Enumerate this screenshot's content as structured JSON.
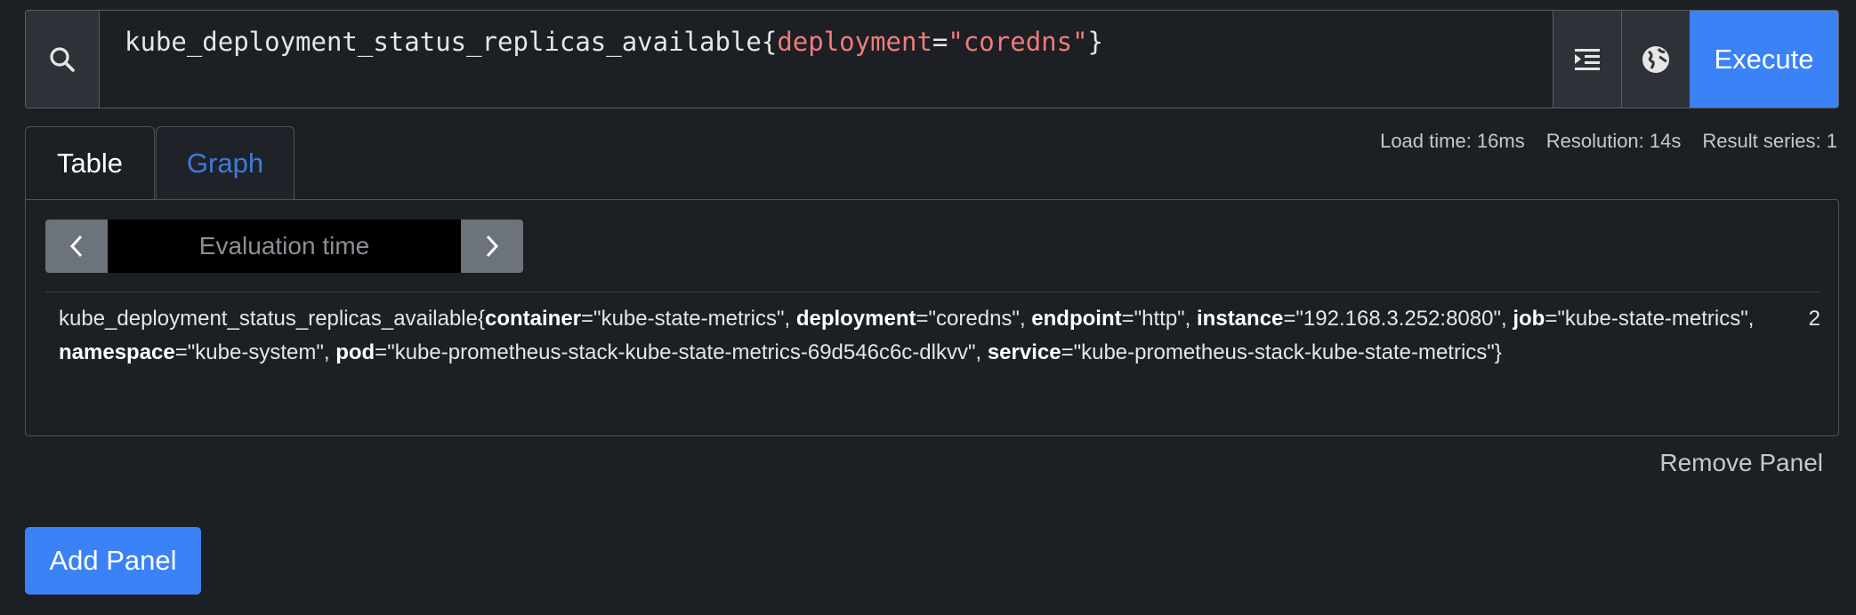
{
  "query": {
    "metric": "kube_deployment_status_replicas_available",
    "open_brace": "{",
    "label_name": "deployment",
    "equals": "=",
    "label_value": "\"coredns\"",
    "close_brace": "}"
  },
  "buttons": {
    "execute": "Execute"
  },
  "tabs": [
    {
      "label": "Table"
    },
    {
      "label": "Graph"
    }
  ],
  "stats": {
    "load_time": "Load time: 16ms",
    "resolution": "Resolution: 14s",
    "result_series": "Result series: 1"
  },
  "eval": {
    "placeholder": "Evaluation time"
  },
  "result": {
    "value": "2",
    "segments": [
      {
        "text": "kube_deployment_status_replicas_available{",
        "bold": false
      },
      {
        "text": "container",
        "bold": true
      },
      {
        "text": "=\"kube-state-metrics\", ",
        "bold": false
      },
      {
        "text": "deployment",
        "bold": true
      },
      {
        "text": "=\"coredns\", ",
        "bold": false
      },
      {
        "text": "endpoint",
        "bold": true
      },
      {
        "text": "=\"http\", ",
        "bold": false
      },
      {
        "text": "instance",
        "bold": true
      },
      {
        "text": "=\"192.168.3.252:8080\", ",
        "bold": false
      },
      {
        "text": "job",
        "bold": true
      },
      {
        "text": "=\"kube-state-metrics\", ",
        "bold": false
      },
      {
        "text": "namespace",
        "bold": true
      },
      {
        "text": "=\"kube-system\", ",
        "bold": false
      },
      {
        "text": "pod",
        "bold": true
      },
      {
        "text": "=\"kube-prometheus-stack-kube-state-metrics-69d546c6c-dlkvv\", ",
        "bold": false
      },
      {
        "text": "service",
        "bold": true
      },
      {
        "text": "=\"kube-prometheus-stack-kube-state-metrics\"}",
        "bold": false
      }
    ]
  },
  "panel": {
    "remove_label": "Remove Panel",
    "add_label": "Add Panel"
  },
  "colors": {
    "accent": "#3b82f6",
    "label_highlight": "#f07b7b",
    "background": "#1c1f24"
  }
}
